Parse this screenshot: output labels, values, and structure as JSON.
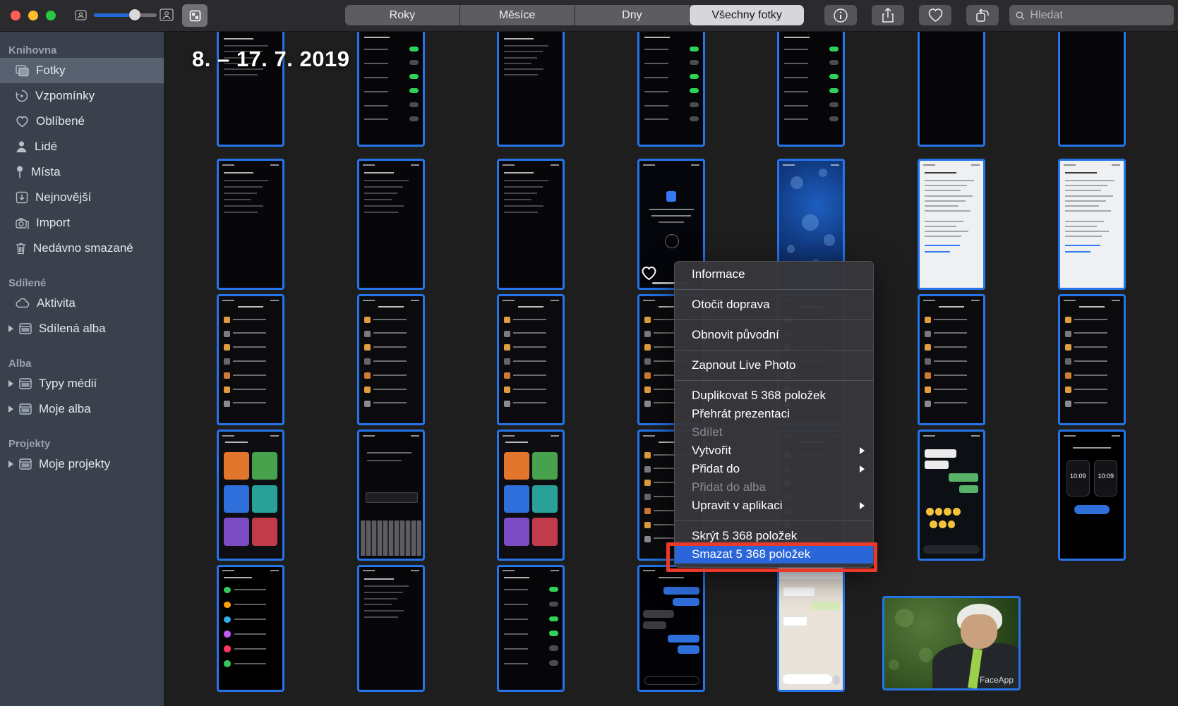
{
  "titlebar": {
    "view_segments": {
      "roky": "Roky",
      "mesice": "Měsíce",
      "dny": "Dny",
      "vsechny_fotky": "Všechny fotky"
    },
    "search_placeholder": "Hledat"
  },
  "sidebar": {
    "section_knihovna": "Knihovna",
    "section_sdilene": "Sdílené",
    "section_alba": "Alba",
    "section_projekty": "Projekty",
    "items": {
      "fotky": "Fotky",
      "vzpominky": "Vzpomínky",
      "oblibene": "Oblíbené",
      "lide": "Lidé",
      "mista": "Místa",
      "nejnovejsi": "Nejnovější",
      "import": "Import",
      "nedavno_smazane": "Nedávno smazané",
      "aktivita": "Aktivita",
      "sdilena_alba": "Sdílená alba",
      "typy_medii": "Typy médií",
      "moje_alba": "Moje alba",
      "moje_projekty": "Moje projekty"
    }
  },
  "content": {
    "date_header": "8. – 17. 7. 2019",
    "watch_time": "10:09",
    "faceapp_watermark": "FaceApp"
  },
  "context_menu": {
    "informace": "Informace",
    "otocit_doprava": "Otočit doprava",
    "obnovit_puvodni": "Obnovit původní",
    "zapnout_live_photo": "Zapnout Live Photo",
    "duplikovat": "Duplikovat 5 368 položek",
    "prehrat_prezentaci": "Přehrát prezentaci",
    "sdilet": "Sdílet",
    "vytvorit": "Vytvořit",
    "pridat_do": "Přidat do",
    "pridat_do_alba": "Přidat do alba",
    "upravit_v_aplikaci": "Upravit v aplikaci",
    "skryt": "Skrýt 5 368 položek",
    "smazat": "Smazat 5 368 položek"
  },
  "colors": {
    "selection_blue": "#2575e8",
    "menu_highlight_blue": "#2a65d9",
    "annotation_red": "#e8392b",
    "slider_accent": "#2569d8",
    "toggle_green": "#30d158",
    "sidebar_bg": "#3a414c",
    "menu_bg": "#37373b"
  }
}
